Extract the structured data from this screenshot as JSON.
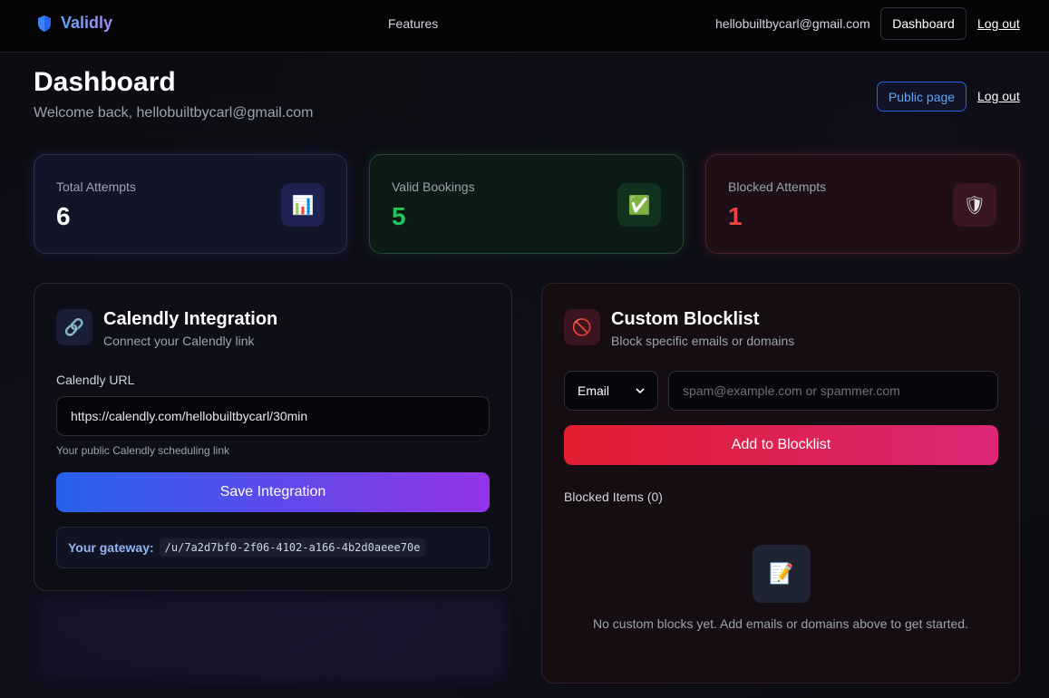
{
  "nav": {
    "brand": "Validly",
    "features": "Features",
    "email": "hellobuiltbycarl@gmail.com",
    "dashboard": "Dashboard",
    "logout": "Log out"
  },
  "header": {
    "title": "Dashboard",
    "subtitle": "Welcome back, hellobuiltbycarl@gmail.com",
    "public_page": "Public page",
    "logout": "Log out"
  },
  "stats": [
    {
      "label": "Total Attempts",
      "value": "6",
      "icon": "bar-chart-icon",
      "glyph": "📊"
    },
    {
      "label": "Valid Bookings",
      "value": "5",
      "icon": "check-icon",
      "glyph": "✅"
    },
    {
      "label": "Blocked Attempts",
      "value": "1",
      "icon": "shield-icon",
      "glyph": "🛡"
    }
  ],
  "calendly": {
    "icon": "link-icon",
    "title": "Calendly Integration",
    "subtitle": "Connect your Calendly link",
    "url_label": "Calendly URL",
    "url_value": "https://calendly.com/hellobuiltbycarl/30min",
    "help": "Your public Calendly scheduling link",
    "save": "Save Integration",
    "gateway_label": "Your gateway:",
    "gateway_value": "/u/7a2d7bf0-2f06-4102-a166-4b2d0aeee70e"
  },
  "blocklist": {
    "icon": "prohibited-icon",
    "title": "Custom Blocklist",
    "subtitle": "Block specific emails or domains",
    "type_selected": "Email",
    "placeholder": "spam@example.com or spammer.com",
    "add": "Add to Blocklist",
    "items_heading": "Blocked Items (0)",
    "empty_icon": "memo-icon",
    "empty_text": "No custom blocks yet. Add emails or domains above to get started."
  },
  "colors": {
    "accent_blue": "#2563eb",
    "accent_purple": "#9333ea",
    "valid_green": "#22c55e",
    "blocked_red": "#ef4444"
  }
}
